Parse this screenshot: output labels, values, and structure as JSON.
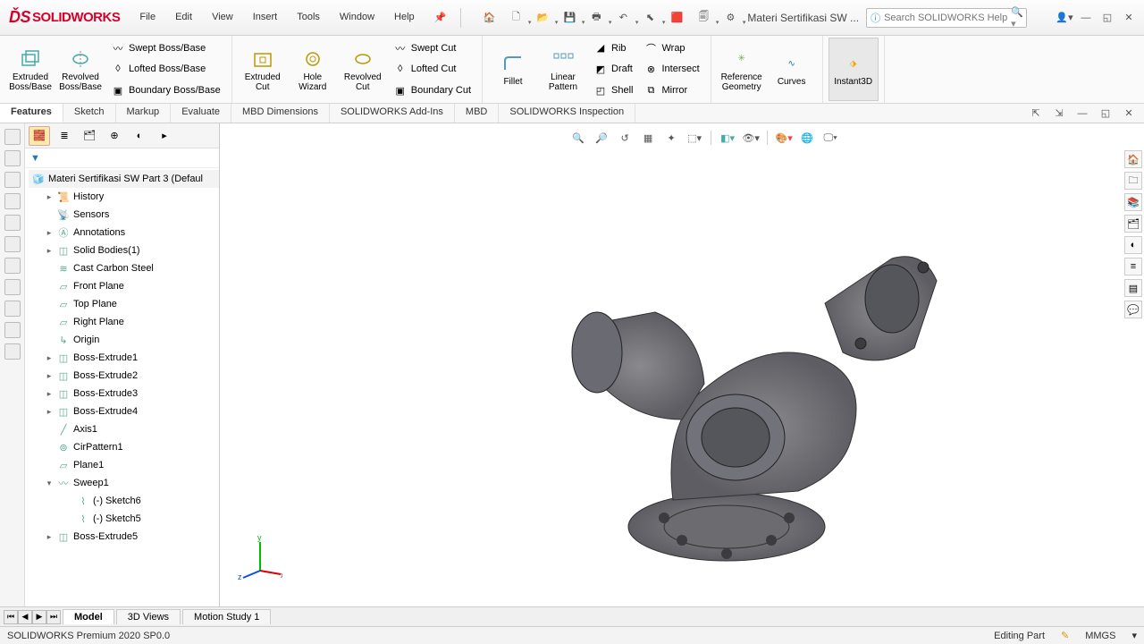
{
  "app": {
    "logo": "SOLIDWORKS"
  },
  "menu": [
    "File",
    "Edit",
    "View",
    "Insert",
    "Tools",
    "Window",
    "Help"
  ],
  "doc_title": "Materi Sertifikasi SW ...",
  "search_placeholder": "Search SOLIDWORKS Help",
  "ribbon": {
    "extruded_boss": "Extruded Boss/Base",
    "revolved_boss": "Revolved Boss/Base",
    "swept_boss": "Swept Boss/Base",
    "lofted_boss": "Lofted Boss/Base",
    "boundary_boss": "Boundary Boss/Base",
    "extruded_cut": "Extruded Cut",
    "hole_wizard": "Hole Wizard",
    "revolved_cut": "Revolved Cut",
    "swept_cut": "Swept Cut",
    "lofted_cut": "Lofted Cut",
    "boundary_cut": "Boundary Cut",
    "fillet": "Fillet",
    "linear_pattern": "Linear Pattern",
    "rib": "Rib",
    "draft": "Draft",
    "shell": "Shell",
    "wrap": "Wrap",
    "intersect": "Intersect",
    "mirror": "Mirror",
    "ref_geom": "Reference Geometry",
    "curves": "Curves",
    "instant3d": "Instant3D"
  },
  "cmd_tabs": [
    "Features",
    "Sketch",
    "Markup",
    "Evaluate",
    "MBD Dimensions",
    "SOLIDWORKS Add-Ins",
    "MBD",
    "SOLIDWORKS Inspection"
  ],
  "tree": {
    "root": "Materi Sertifikasi SW Part 3  (Defaul",
    "items": [
      {
        "label": "History",
        "exp": "▸"
      },
      {
        "label": "Sensors",
        "exp": ""
      },
      {
        "label": "Annotations",
        "exp": "▸"
      },
      {
        "label": "Solid Bodies(1)",
        "exp": "▸"
      },
      {
        "label": "Cast Carbon Steel",
        "exp": ""
      },
      {
        "label": "Front Plane",
        "exp": ""
      },
      {
        "label": "Top Plane",
        "exp": ""
      },
      {
        "label": "Right Plane",
        "exp": ""
      },
      {
        "label": "Origin",
        "exp": ""
      },
      {
        "label": "Boss-Extrude1",
        "exp": "▸"
      },
      {
        "label": "Boss-Extrude2",
        "exp": "▸"
      },
      {
        "label": "Boss-Extrude3",
        "exp": "▸"
      },
      {
        "label": "Boss-Extrude4",
        "exp": "▸"
      },
      {
        "label": "Axis1",
        "exp": ""
      },
      {
        "label": "CirPattern1",
        "exp": ""
      },
      {
        "label": "Plane1",
        "exp": ""
      },
      {
        "label": "Sweep1",
        "exp": "▾"
      },
      {
        "label": "(-) Sketch6",
        "exp": "",
        "indent": 2
      },
      {
        "label": "(-) Sketch5",
        "exp": "",
        "indent": 2
      },
      {
        "label": "Boss-Extrude5",
        "exp": "▸"
      }
    ]
  },
  "bottom_tabs": [
    "Model",
    "3D Views",
    "Motion Study 1"
  ],
  "status": {
    "left": "SOLIDWORKS Premium 2020 SP0.0",
    "mode": "Editing Part",
    "units": "MMGS"
  }
}
